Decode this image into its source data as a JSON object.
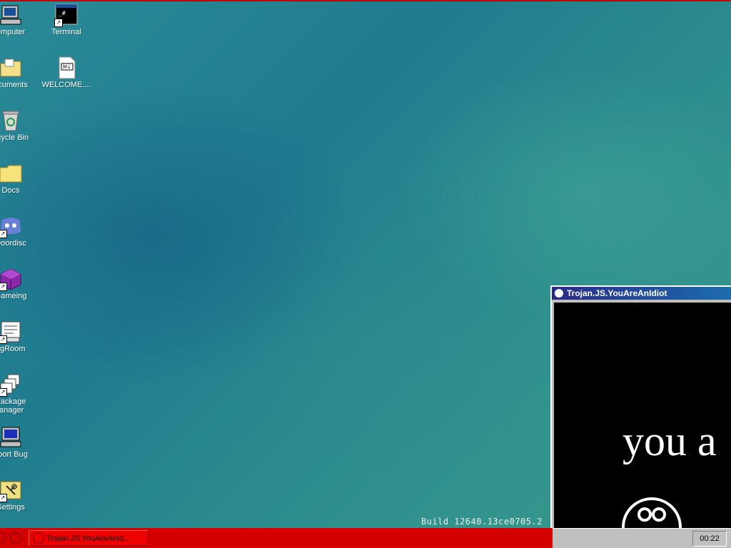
{
  "desktop": {
    "icons": [
      {
        "label": "omputer",
        "icon": "computer-icon"
      },
      {
        "label": "Terminal",
        "icon": "terminal-icon"
      },
      {
        "label": "ocuments",
        "icon": "documents-folder-icon"
      },
      {
        "label": "WELCOME....",
        "icon": "markdown-file-icon"
      },
      {
        "label": "ecycle Bin",
        "icon": "recycle-bin-icon"
      },
      {
        "label": "Docs",
        "icon": "folder-icon"
      },
      {
        "label": "Doordisc",
        "icon": "chat-app-icon"
      },
      {
        "label": "Gameing",
        "icon": "game-cube-icon"
      },
      {
        "label": "sgRoom",
        "icon": "message-room-icon"
      },
      {
        "label": "Package",
        "label2": "lanager",
        "icon": "package-manager-icon"
      },
      {
        "label": "eport Bug",
        "icon": "report-bug-icon"
      },
      {
        "label": "Settings",
        "icon": "settings-icon"
      }
    ],
    "build_text": "Build 12640.13ce0705.2"
  },
  "window": {
    "title": "Trojan.JS.YouAreAnIdiot",
    "content_text": "you a"
  },
  "taskbar": {
    "task_label": "Trojan.JS.YouAreAnId...",
    "clock": "00:22"
  },
  "colors": {
    "taskbar": "#d40000",
    "title_bar": "#1b4f9a",
    "tray": "#c0c0c0"
  }
}
